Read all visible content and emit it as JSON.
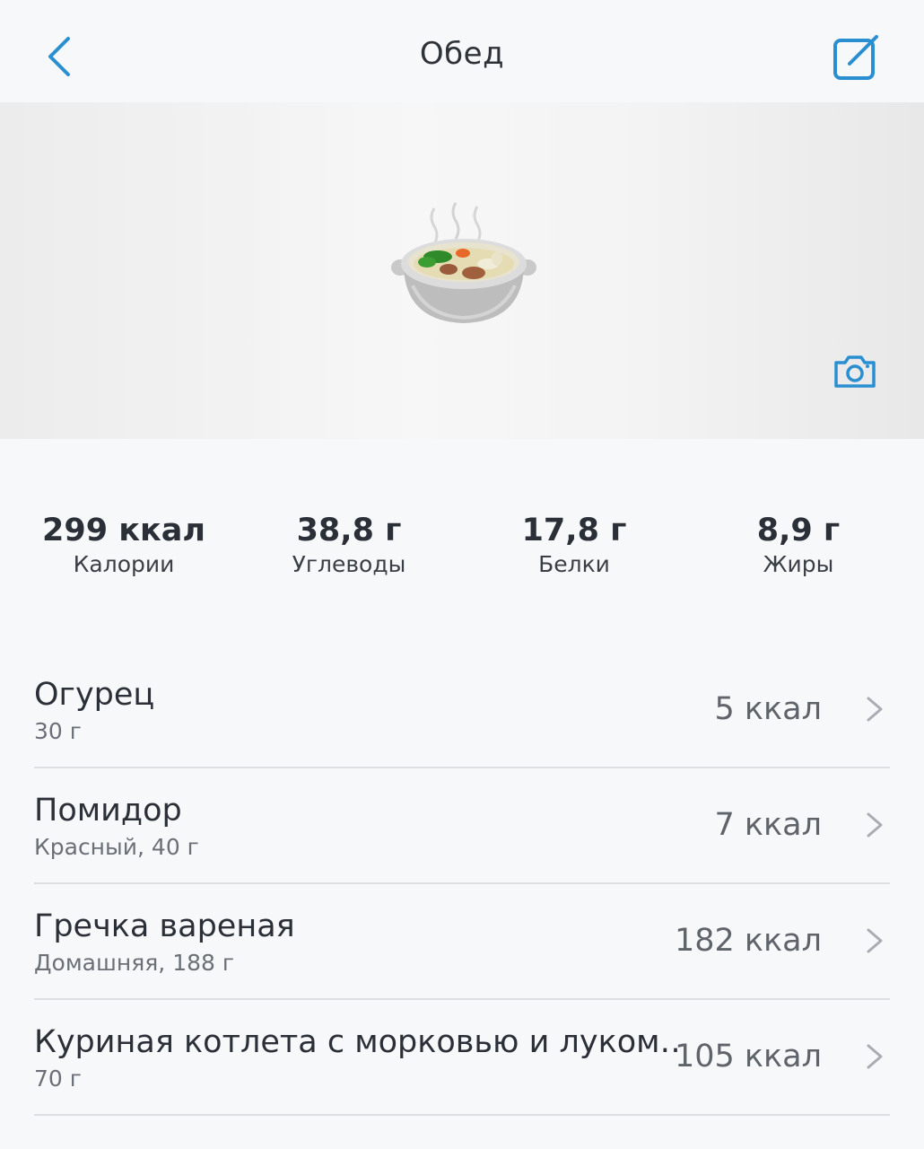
{
  "header": {
    "title": "Обед",
    "back_icon": "chevron-left-icon",
    "edit_icon": "edit-icon"
  },
  "photo": {
    "image": "soup-bowl-emoji",
    "camera_icon": "camera-icon"
  },
  "macros": [
    {
      "value": "299 ккал",
      "label": "Калории"
    },
    {
      "value": "38,8 г",
      "label": "Углеводы"
    },
    {
      "value": "17,8 г",
      "label": "Белки"
    },
    {
      "value": "8,9 г",
      "label": "Жиры"
    }
  ],
  "items": [
    {
      "name": "Огурец",
      "sub": "30 г",
      "kcal": "5 ккал"
    },
    {
      "name": "Помидор",
      "sub": "Красный, 40 г",
      "kcal": "7 ккал"
    },
    {
      "name": "Гречка вареная",
      "sub": "Домашняя, 188 г",
      "kcal": "182 ккал"
    },
    {
      "name": "Куриная котлета с морковью и луком…",
      "sub": "70 г",
      "kcal": "105 ккал"
    }
  ],
  "colors": {
    "accent": "#2a8fd0",
    "background": "#f7f8fa",
    "divider": "#dcdee2"
  }
}
